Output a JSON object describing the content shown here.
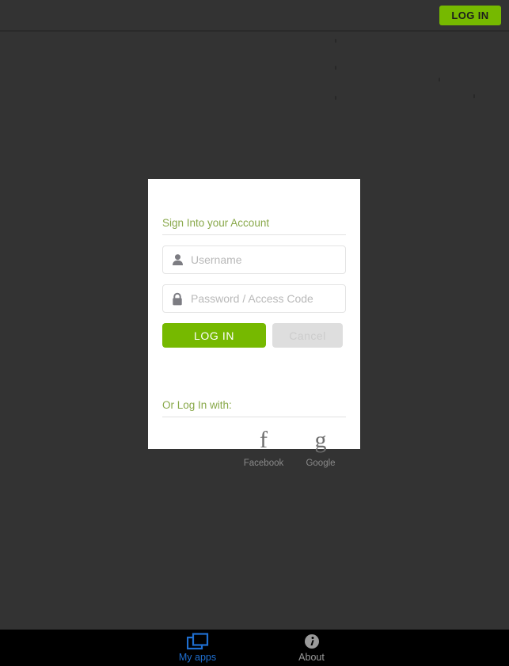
{
  "header": {
    "login_button_label": "LOG IN",
    "background_color": "#333333",
    "accent_green": "#76b900"
  },
  "card": {
    "title": "Sign Into your Account",
    "title_color": "#88a849",
    "username": {
      "icon": "person-icon",
      "placeholder": "Username",
      "value": ""
    },
    "password": {
      "icon": "lock-icon",
      "placeholder": "Password / Access Code",
      "value": ""
    },
    "login_button_label": "LOG IN",
    "cancel_button_label": "Cancel",
    "social": {
      "title": "Or Log In with:",
      "providers": [
        {
          "glyph": "f",
          "label": "Facebook",
          "icon": "facebook-icon"
        },
        {
          "glyph": "g",
          "label": "Google",
          "icon": "google-icon"
        }
      ]
    }
  },
  "bottom_nav": {
    "items": [
      {
        "label": "My apps",
        "icon": "windows-stack-icon",
        "active": true,
        "color": "#1f6fd0"
      },
      {
        "label": "About",
        "icon": "info-circle-icon",
        "active": false,
        "color": "#9a9a9a"
      }
    ]
  }
}
